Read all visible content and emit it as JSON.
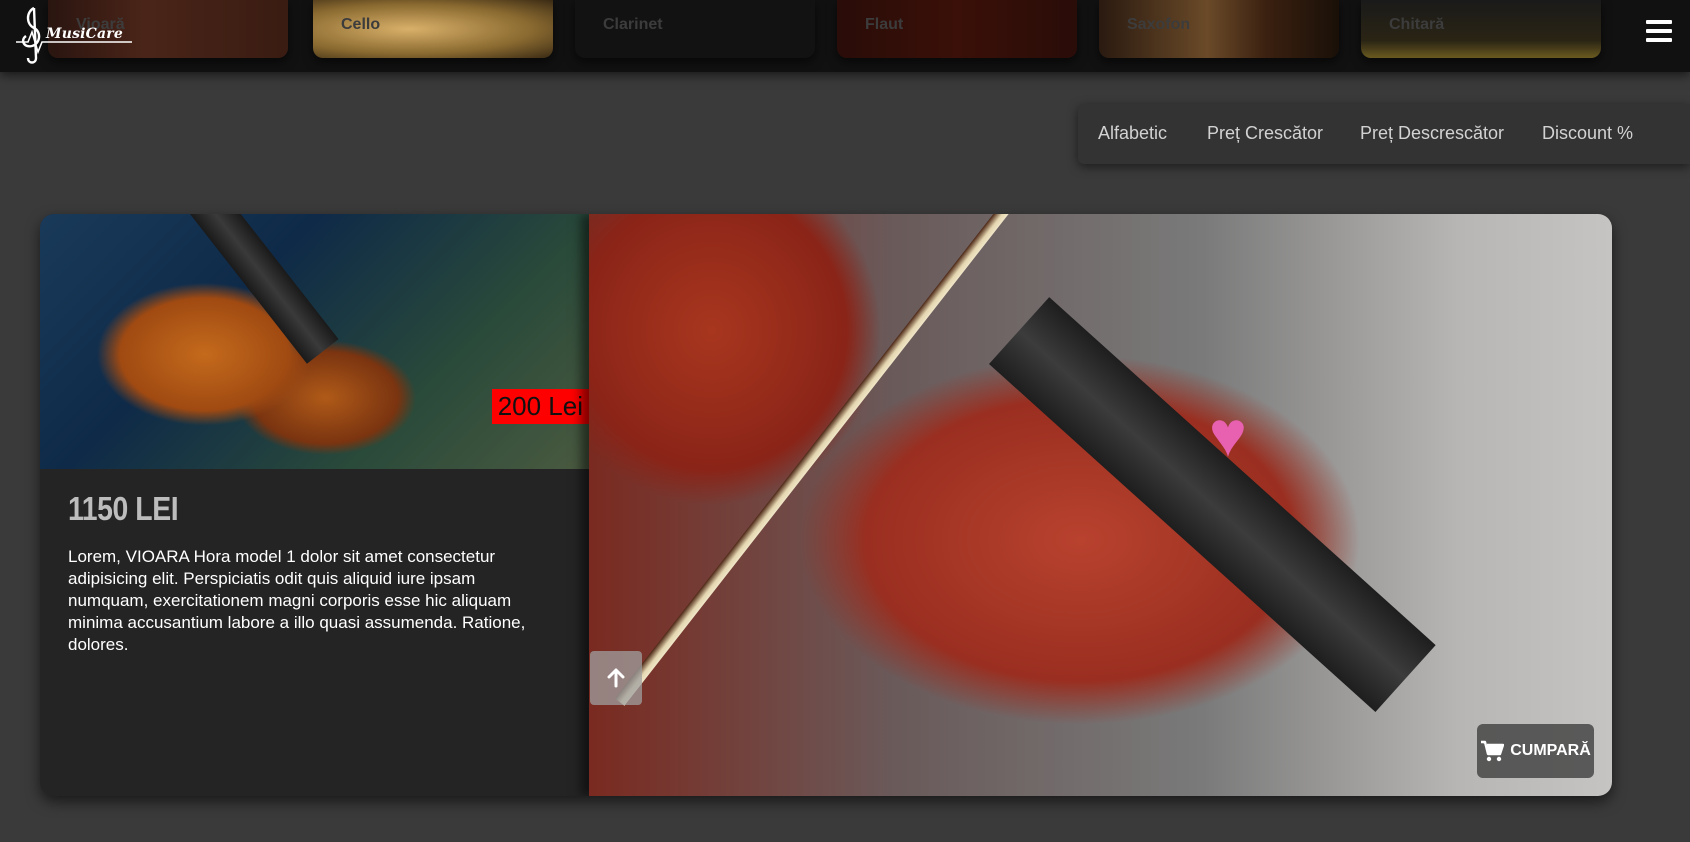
{
  "header": {
    "logo_text": "MusiCare",
    "categories": [
      "Vioară",
      "Cello",
      "Clarinet",
      "Flaut",
      "Saxofon",
      "Chitară"
    ]
  },
  "sort": {
    "options": [
      "Alfabetic",
      "Preț Crescător",
      "Preț Descrescător",
      "Discount %"
    ]
  },
  "product": {
    "old_price": "200 Lei",
    "price": "1150 LEI",
    "description": "Lorem, VIOARA Hora model 1 dolor sit amet consectetur adipisicing elit. Perspiciatis odit quis aliquid iure ipsam numquam, exercitationem magni corporis esse hic aliquam minima accusantium labore a illo quasi assumenda. Ratione, dolores.",
    "buy_label": "CUMPARĂ"
  },
  "colors": {
    "background": "#3a3a3a",
    "topbar": "#111111",
    "card": "#242424",
    "price_badge": "#ff0000"
  },
  "icons": {
    "menu": "hamburger-icon",
    "cart": "cart-icon",
    "scroll_up": "arrow-up-icon"
  }
}
